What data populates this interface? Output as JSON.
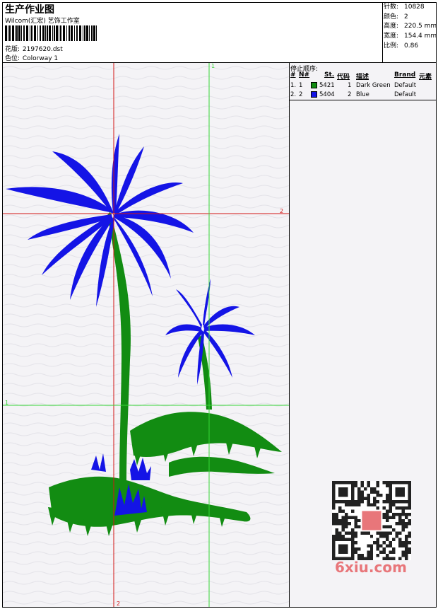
{
  "header": {
    "title": "生产作业图",
    "company": "Wilcom(汇宏) 艺饰工作室",
    "design_label": "花版:",
    "design_value": "2197620.dst",
    "colorway_label": "色位:",
    "colorway_value": "Colorway 1"
  },
  "stats": [
    {
      "label": "针数:",
      "value": "10828"
    },
    {
      "label": "颜色:",
      "value": "2"
    },
    {
      "label": "高度:",
      "value": "220.5 mm"
    },
    {
      "label": "宽度:",
      "value": "154.4 mm"
    },
    {
      "label": "比例:",
      "value": "0.86"
    }
  ],
  "stop_sequence": {
    "title": "停止顺序:",
    "headers": {
      "num": "#",
      "no": "N#",
      "st": "St.",
      "code": "代码",
      "desc": "描述",
      "brand": "Brand",
      "element": "元素"
    },
    "rows": [
      {
        "num": "1.",
        "no": "1",
        "color": "#128c12",
        "st": "5421",
        "code": "1",
        "desc": "Dark Green",
        "brand": "Default"
      },
      {
        "num": "2.",
        "no": "2",
        "color": "#1414e6",
        "st": "5404",
        "code": "2",
        "desc": "Blue",
        "brand": "Default"
      }
    ]
  },
  "axes": {
    "top_green": "1",
    "right_red": "2",
    "left_green": "1",
    "bottom_red": "2"
  },
  "colors": {
    "green": "#128c12",
    "blue": "#1414e6",
    "red_guide": "#d21414",
    "green_guide": "#36d636"
  },
  "watermark": {
    "logo": "6xiu.com"
  }
}
